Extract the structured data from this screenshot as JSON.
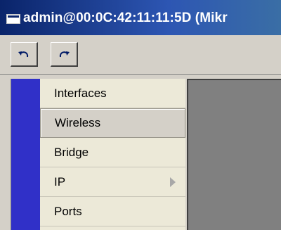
{
  "window": {
    "title": "admin@00:0C:42:11:11:5D (Mikr"
  },
  "toolbar": {
    "undo_icon": "undo-icon",
    "redo_icon": "redo-icon"
  },
  "menu": {
    "items": [
      {
        "label": "Interfaces",
        "selected": false,
        "has_submenu": false
      },
      {
        "label": "Wireless",
        "selected": true,
        "has_submenu": false
      },
      {
        "label": "Bridge",
        "selected": false,
        "has_submenu": false
      },
      {
        "label": "IP",
        "selected": false,
        "has_submenu": true
      },
      {
        "label": "Ports",
        "selected": false,
        "has_submenu": false
      }
    ]
  },
  "colors": {
    "titlebar_start": "#0a246a",
    "titlebar_end": "#3a6ea5",
    "menu_strip": "#3030c8",
    "workspace": "#808080"
  }
}
